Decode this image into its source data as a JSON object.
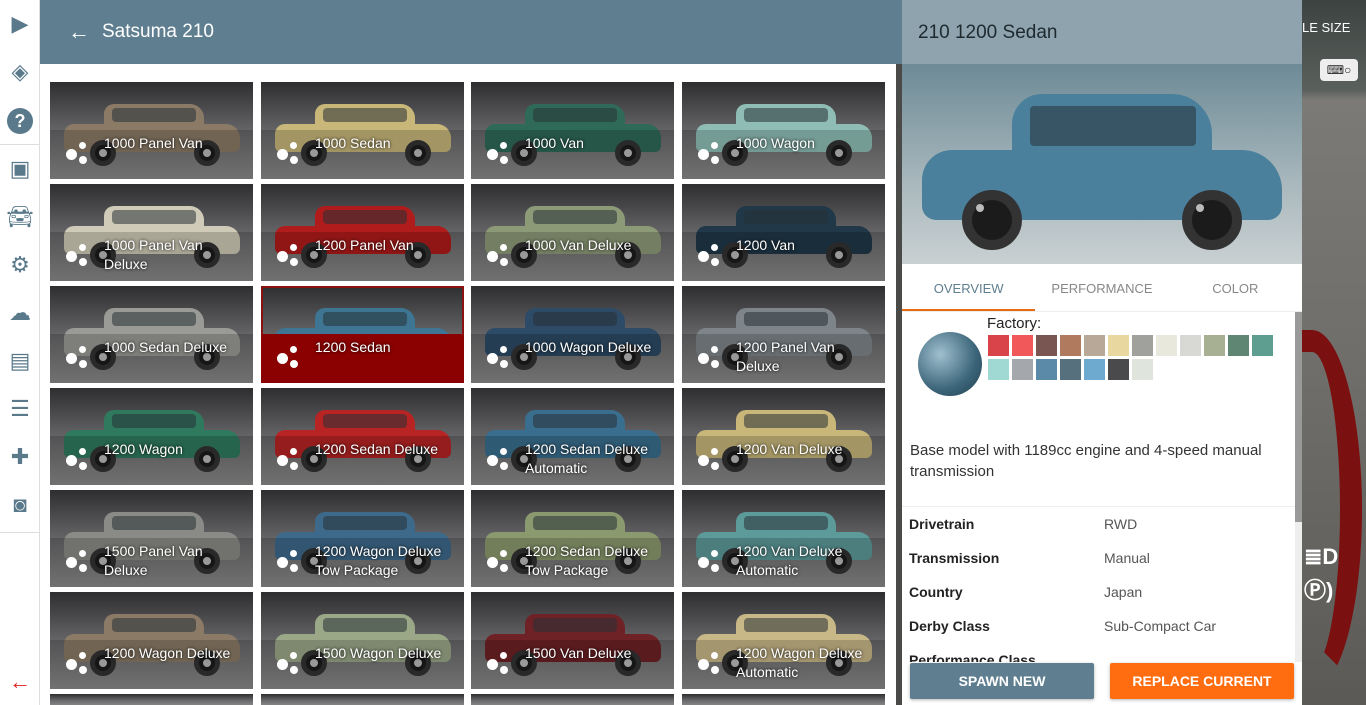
{
  "header": {
    "title": "Satsuma 210",
    "back_icon": "arrow-left"
  },
  "sidebar": {
    "icons": [
      "play-icon",
      "layers-icon",
      "help-icon",
      "mission-icon",
      "car-icon",
      "gear-icon",
      "cloud-icon",
      "dashboard-icon",
      "sliders-icon",
      "gamepad-icon",
      "camera-icon"
    ],
    "exit_icon": "arrow-left-red"
  },
  "tiles": [
    {
      "label": "1000 Panel Van",
      "color": "#8a7a66"
    },
    {
      "label": "1000 Sedan",
      "color": "#c9b77a"
    },
    {
      "label": "1000 Van",
      "color": "#2f6a58"
    },
    {
      "label": "1000 Wagon",
      "color": "#8fbdb6"
    },
    {
      "label": "1000 Panel Van Deluxe",
      "color": "#cfcbb8"
    },
    {
      "label": "1200 Panel Van",
      "color": "#b01c1c"
    },
    {
      "label": "1000 Van Deluxe",
      "color": "#8d9a78"
    },
    {
      "label": "1200 Van",
      "color": "#203848"
    },
    {
      "label": "1000 Sedan Deluxe",
      "color": "#9a9a96"
    },
    {
      "label": "1200 Sedan",
      "color": "#3d7593",
      "selected": true
    },
    {
      "label": "1000 Wagon Deluxe",
      "color": "#2d4b66"
    },
    {
      "label": "1200 Panel Van Deluxe",
      "color": "#7e858a"
    },
    {
      "label": "1200 Wagon",
      "color": "#2f7a5e"
    },
    {
      "label": "1200 Sedan Deluxe",
      "color": "#b82424"
    },
    {
      "label": "1200 Sedan Deluxe Automatic",
      "color": "#3a6e8e"
    },
    {
      "label": "1200 Van Deluxe",
      "color": "#c9b77a"
    },
    {
      "label": "1500 Panel Van Deluxe",
      "color": "#8a8a86"
    },
    {
      "label": "1200 Wagon Deluxe Tow Package",
      "color": "#3d6a8a"
    },
    {
      "label": "1200 Sedan Deluxe Tow Package",
      "color": "#8b9a6e"
    },
    {
      "label": "1200 Van Deluxe Automatic",
      "color": "#5d9a9a"
    },
    {
      "label": "1200 Wagon Deluxe",
      "color": "#8a7a66"
    },
    {
      "label": "1500 Wagon Deluxe",
      "color": "#9aa888"
    },
    {
      "label": "1500 Van Deluxe",
      "color": "#6e2226"
    },
    {
      "label": "1200 Wagon Deluxe Automatic",
      "color": "#c8b888"
    }
  ],
  "panel": {
    "title": "210 1200 Sedan",
    "car_color": "#4a809c",
    "tabs": [
      "OVERVIEW",
      "PERFORMANCE",
      "COLOR"
    ],
    "factory_label": "Factory:",
    "swatches": [
      "#d9434a",
      "#f0585a",
      "#7a5652",
      "#b07a5e",
      "#b8a898",
      "#e8d8a0",
      "#a0a09c",
      "#e8e8dc",
      "#d8d8d4",
      "#a8b094",
      "#5e8672",
      "#5e9e90",
      "#a0d8d4",
      "#a4a8ac",
      "#5a8aa8",
      "#56707e",
      "#6eaad0",
      "#4a4a4c",
      "#dfe4dc"
    ],
    "description": "Base model with 1189cc engine and 4-speed manual transmission",
    "specs": [
      {
        "k": "Drivetrain",
        "v": "RWD"
      },
      {
        "k": "Transmission",
        "v": "Manual"
      },
      {
        "k": "Country",
        "v": "Japan"
      },
      {
        "k": "Derby Class",
        "v": "Sub-Compact Car"
      },
      {
        "k": "Performance Class",
        "v": "..."
      }
    ],
    "spawn_label": "SPAWN NEW",
    "replace_label": "REPLACE CURRENT"
  },
  "overlay": {
    "size_text": "LE SIZE",
    "kbd_icon": "keyboard-toggle"
  }
}
